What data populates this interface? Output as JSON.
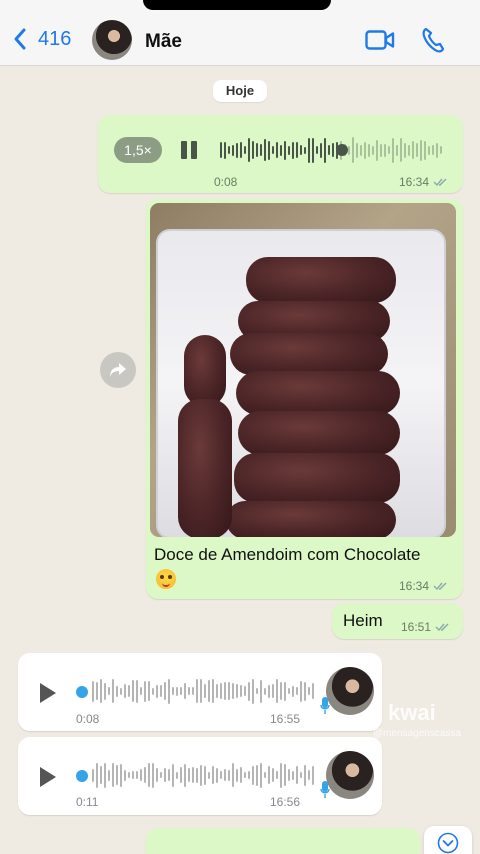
{
  "header": {
    "back_count": "416",
    "contact_name": "Mãe"
  },
  "date_label": "Hoje",
  "messages": [
    {
      "type": "audio_out",
      "speed": "1,5×",
      "duration": "0:08",
      "time": "16:34",
      "status": "read"
    },
    {
      "type": "image_out",
      "caption": "Doce de Amendoim com Chocolate",
      "time": "16:34",
      "status": "read"
    },
    {
      "type": "text_out",
      "text": "Heim",
      "time": "16:51",
      "status": "read"
    },
    {
      "type": "audio_in",
      "duration": "0:08",
      "time": "16:55"
    },
    {
      "type": "audio_in",
      "duration": "0:11",
      "time": "16:56"
    }
  ],
  "watermark": {
    "brand": "kwai",
    "handle": "@mensagenscassa"
  },
  "colors": {
    "accent": "#1f7ae8",
    "outgoing_bubble": "#dcf8c6",
    "incoming_bubble": "#ffffff",
    "chat_background": "#efeae2",
    "audio_progress": "#35a3e8"
  },
  "icons": [
    "chevron-left-icon",
    "video-icon",
    "phone-icon",
    "pause-icon",
    "play-icon",
    "forward-icon",
    "mic-icon",
    "double-check-icon",
    "chevron-down-icon"
  ]
}
